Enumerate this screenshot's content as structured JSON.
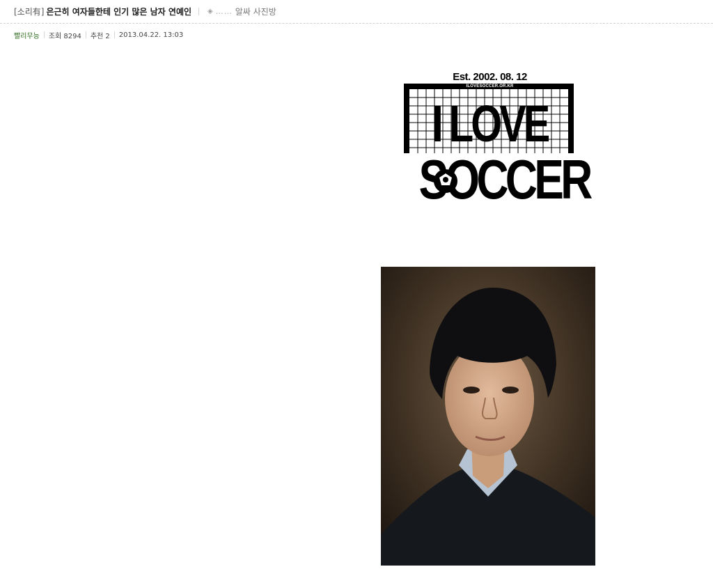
{
  "post": {
    "category": "[소리有]",
    "title": "은근히 여자들한테 인기 많은 남자 연예인",
    "board_dots": "……",
    "board_name": "알싸 사진방"
  },
  "meta": {
    "author": "빨리무능",
    "views": "조회 8294",
    "likes": "추천 2",
    "datetime": "2013.04.22. 13:03"
  },
  "logo": {
    "est": "Est. 2002. 08. 12",
    "url": "ILOVESOCCER.OR.KR",
    "line1": "I LOVE",
    "line2": "SOCCER"
  },
  "icons": {
    "diamond": "diamond-icon",
    "ball": "soccer-ball-icon"
  }
}
